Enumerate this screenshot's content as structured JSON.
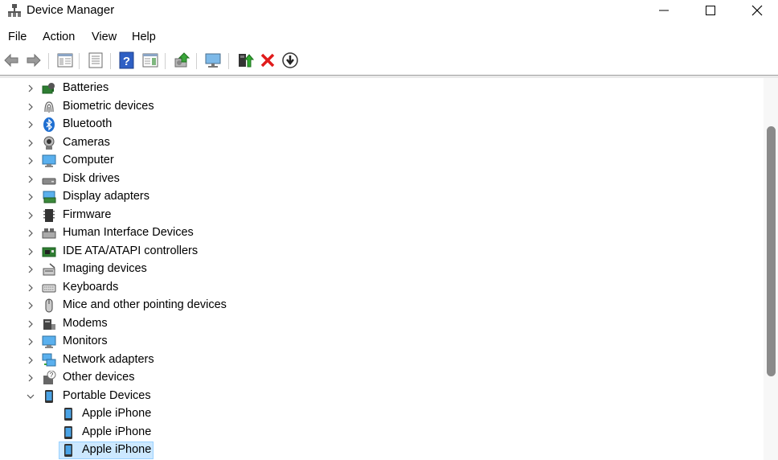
{
  "window": {
    "title": "Device Manager"
  },
  "menu": [
    "File",
    "Action",
    "View",
    "Help"
  ],
  "toolbar": [
    "back",
    "forward",
    "show-hide-console-tree",
    "properties",
    "help",
    "action-pane",
    "scan-hardware",
    "monitor",
    "update-driver",
    "uninstall-device",
    "disable-device"
  ],
  "tree": {
    "categories": [
      {
        "label": "Batteries",
        "icon": "battery-icon"
      },
      {
        "label": "Biometric devices",
        "icon": "fingerprint-icon"
      },
      {
        "label": "Bluetooth",
        "icon": "bluetooth-icon"
      },
      {
        "label": "Cameras",
        "icon": "camera-icon"
      },
      {
        "label": "Computer",
        "icon": "computer-icon"
      },
      {
        "label": "Disk drives",
        "icon": "disk-drive-icon"
      },
      {
        "label": "Display adapters",
        "icon": "display-adapter-icon"
      },
      {
        "label": "Firmware",
        "icon": "firmware-icon"
      },
      {
        "label": "Human Interface Devices",
        "icon": "hid-icon"
      },
      {
        "label": "IDE ATA/ATAPI controllers",
        "icon": "ide-controller-icon"
      },
      {
        "label": "Imaging devices",
        "icon": "imaging-icon"
      },
      {
        "label": "Keyboards",
        "icon": "keyboard-icon"
      },
      {
        "label": "Mice and other pointing devices",
        "icon": "mouse-icon"
      },
      {
        "label": "Modems",
        "icon": "modem-icon"
      },
      {
        "label": "Monitors",
        "icon": "monitor-icon"
      },
      {
        "label": "Network adapters",
        "icon": "network-adapter-icon"
      },
      {
        "label": "Other devices",
        "icon": "other-devices-icon"
      },
      {
        "label": "Portable Devices",
        "icon": "portable-device-icon",
        "expanded": true
      }
    ],
    "portable_children": [
      {
        "label": "Apple iPhone"
      },
      {
        "label": "Apple iPhone"
      },
      {
        "label": "Apple iPhone",
        "selected": true
      }
    ]
  },
  "colors": {
    "selection_bg": "#cce8ff",
    "selection_border": "#99d1ff",
    "accent": "#0a7ad6"
  }
}
